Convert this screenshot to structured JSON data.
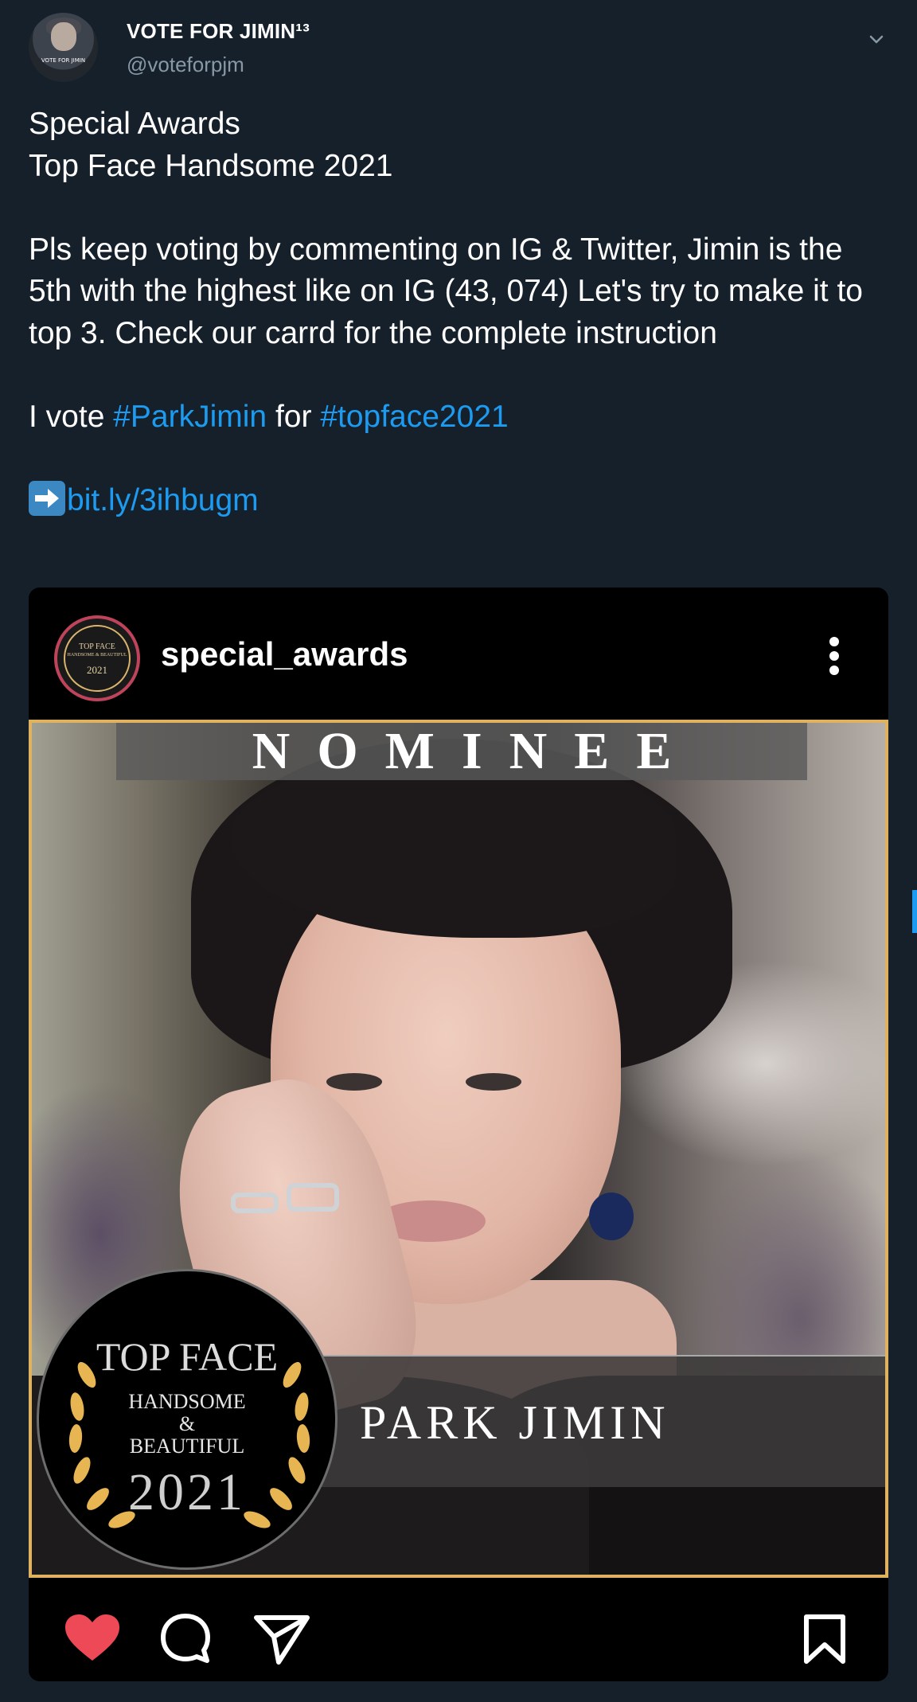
{
  "tweet": {
    "display_name": "VOTE FOR JIMIN¹³",
    "handle": "@voteforpjm",
    "line1": "Special Awards",
    "line2": "Top Face Handsome 2021",
    "paragraph": "Pls keep voting by commenting on IG & Twitter, Jimin is the 5th with the highest like on IG (43, 074) Let's try to make it to top 3. Check our carrd for the complete instruction",
    "vote_prefix": "I vote ",
    "hashtag1": "#ParkJimin",
    "vote_middle": " for ",
    "hashtag2": "#topface2021",
    "link": "bit.ly/3ihbugm",
    "avatar_text": "VOTE FOR JIMIN"
  },
  "embedded_post": {
    "username": "special_awards",
    "logo_text_top": "TOP FACE",
    "logo_text_mid": "HANDSOME & BEAUTIFUL",
    "logo_text_year": "2021",
    "banner_top": "NOMINEE",
    "badge_title": "TOP FACE",
    "badge_line1": "HANDSOME",
    "badge_line2": "&",
    "badge_line3": "BEAUTIFUL",
    "badge_year": "2021",
    "nominee_name": "PARK JIMIN"
  },
  "icons": {
    "caret": "chevron-down-icon",
    "more": "vertical-dots-icon",
    "like": "heart-icon",
    "comment": "speech-bubble-icon",
    "share": "paper-plane-icon",
    "save": "bookmark-icon",
    "arrow_emoji": "right-arrow-emoji"
  },
  "colors": {
    "background": "#15202b",
    "link": "#1d9bf0",
    "handle": "#8899a6",
    "heart": "#ed4956",
    "frame": "#e0b15f"
  }
}
